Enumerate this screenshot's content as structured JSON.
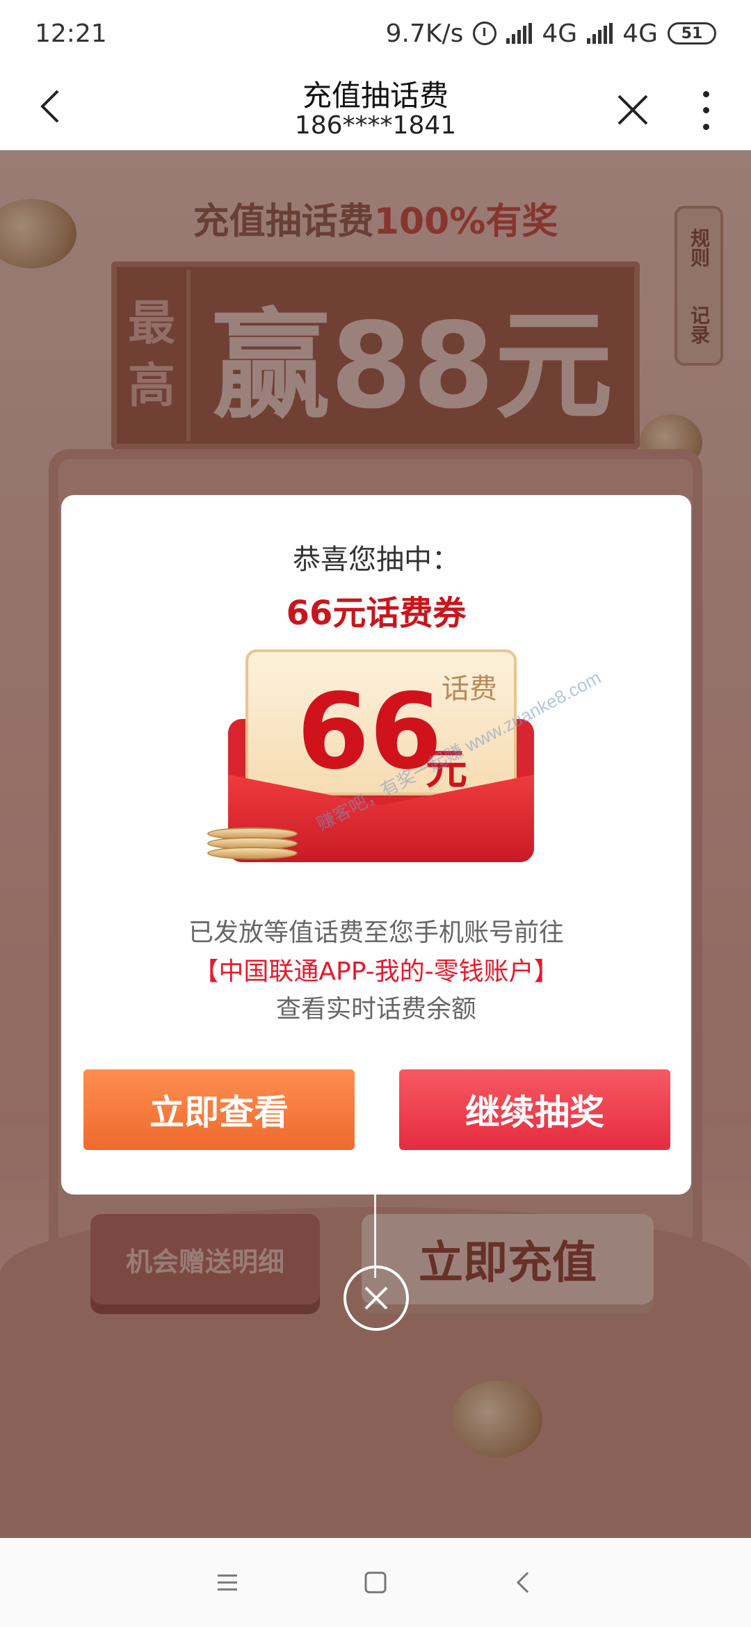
{
  "status_bar": {
    "time": "12:21",
    "speed": "9.7K/s",
    "network1": "4G",
    "network2": "4G",
    "battery": "51"
  },
  "title_bar": {
    "title": "充值抽话费",
    "subtitle": "186****1841"
  },
  "background": {
    "headline_prefix": "充值抽话费",
    "headline_highlight": "100%有奖",
    "panel_small": "最高",
    "panel_big": "赢88元",
    "side_rules": "规则",
    "side_records": "记录",
    "btn_left": "机会赠送明细",
    "btn_right": "立即充值"
  },
  "modal": {
    "congrats": "恭喜您抽中：",
    "prize": "66元话费券",
    "card_tag": "话费",
    "card_amount": "66",
    "card_unit": "元",
    "info_line1": "已发放等值话费至您手机账号前往",
    "info_line2": "【中国联通APP-我的-零钱账户】",
    "info_line3": "查看实时话费余额",
    "btn_view": "立即查看",
    "btn_continue": "继续抽奖"
  },
  "watermark": "赚客吧，有奖一起赚 www.zuanke8.com",
  "colors": {
    "prize_red": "#c8161d",
    "link_red": "#e8182a",
    "btn_orange": "#ef6a2e",
    "btn_red": "#e52c40"
  }
}
